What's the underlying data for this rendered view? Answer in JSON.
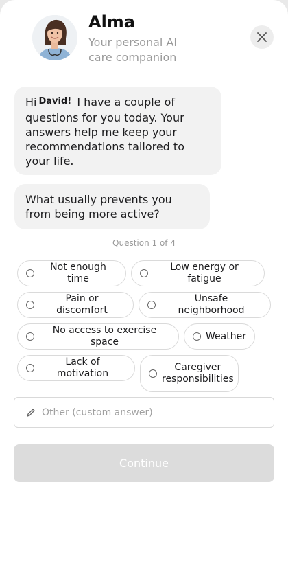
{
  "header": {
    "title": "Alma",
    "subtitle": "Your personal AI care companion",
    "avatar_icon": "nurse-avatar-icon",
    "close_icon": "close-icon"
  },
  "messages": {
    "greeting_prefix": "Hi",
    "user_name": "David!",
    "greeting_body": "I have a couple of questions for you today. Your answers help me keep your recommendations tailored to your life.",
    "question": "What usually prevents you from being more active?"
  },
  "progress": "Question 1 of 4",
  "options": [
    "Not enough time",
    "Low energy or fatigue",
    "Pain or discomfort",
    "Unsafe neighborhood",
    "No access to exercise space",
    "Weather",
    "Lack of motivation",
    "Caregiver responsibilities"
  ],
  "other_input": {
    "placeholder": "Other (custom answer)",
    "icon": "pencil-icon"
  },
  "continue_label": "Continue",
  "colors": {
    "bubble": "#f2f2f2",
    "muted_text": "#9a9a9a",
    "disabled_button": "#dcdcdc"
  }
}
